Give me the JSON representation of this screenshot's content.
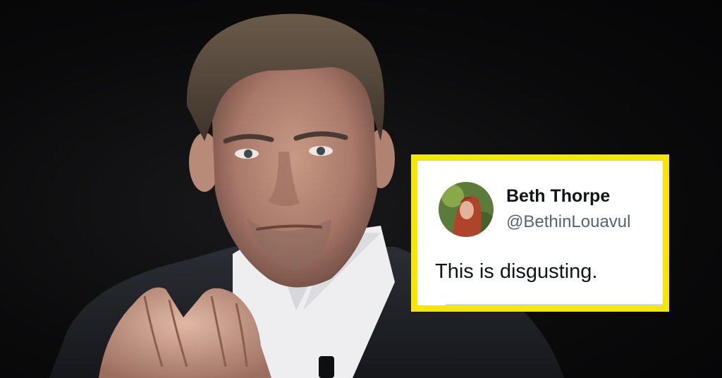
{
  "tweet": {
    "display_name": "Beth Thorpe",
    "handle": "@BethinLouavul",
    "text": "This is disgusting."
  },
  "colors": {
    "frame_border": "#f6e600",
    "background": "#0b0b0c",
    "display_name": "#0f1419",
    "handle": "#536471"
  },
  "icons": {
    "avatar": "avatar-photo"
  }
}
